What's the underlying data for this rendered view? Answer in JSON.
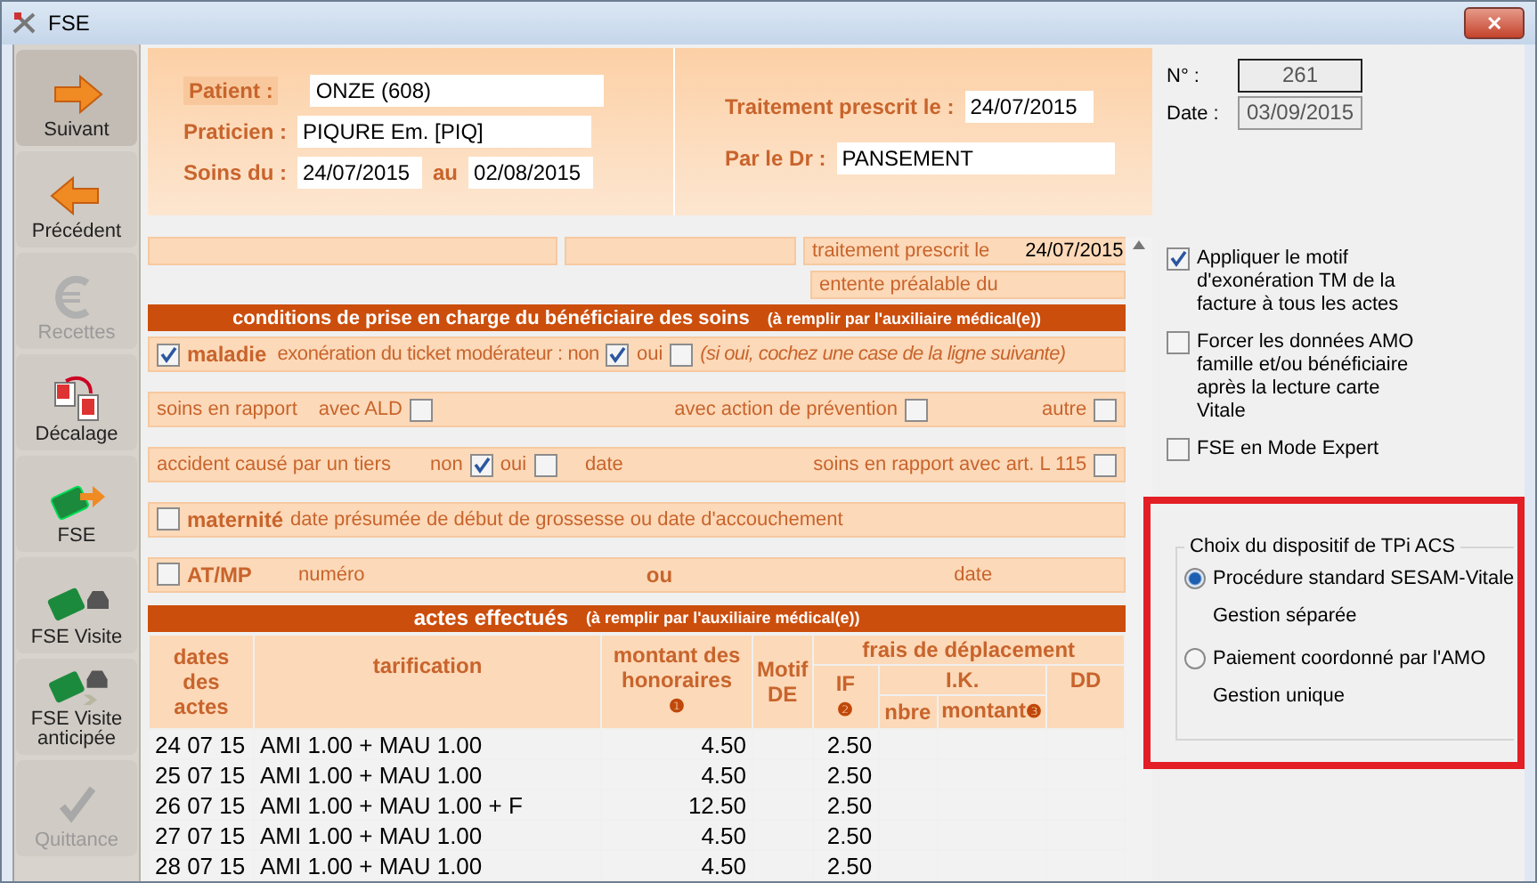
{
  "window": {
    "title": "FSE",
    "close": "✕"
  },
  "sidebar": {
    "items": [
      {
        "label": "Suivant",
        "kind": "next",
        "selected": true,
        "disabled": false
      },
      {
        "label": "Précédent",
        "kind": "previous",
        "selected": false,
        "disabled": false
      },
      {
        "label": "Recettes",
        "kind": "euro",
        "selected": false,
        "disabled": true
      },
      {
        "label": "Décalage",
        "kind": "calendar",
        "selected": false,
        "disabled": false
      },
      {
        "label": "FSE",
        "kind": "card",
        "selected": false,
        "disabled": false
      },
      {
        "label": "FSE Visite",
        "kind": "card-car",
        "selected": false,
        "disabled": false
      },
      {
        "label": "FSE Visite anticipée",
        "kind": "card-car-fast",
        "selected": false,
        "disabled": false
      },
      {
        "label": "Quittance",
        "kind": "check",
        "selected": false,
        "disabled": true
      }
    ]
  },
  "header": {
    "patient": {
      "label": "Patient :",
      "value": "ONZE (608)"
    },
    "praticien": {
      "label": "Praticien :",
      "value": "PIQURE Em. [PIQ]"
    },
    "soins": {
      "label": "Soins du :",
      "from": "24/07/2015",
      "to_label": "au",
      "to": "02/08/2015"
    },
    "traitement": {
      "label": "Traitement prescrit le :",
      "value": "24/07/2015"
    },
    "docteur": {
      "label": "Par le Dr :",
      "value": "PANSEMENT"
    }
  },
  "invoice": {
    "number": {
      "label": "N° :",
      "value": "261"
    },
    "date": {
      "label": "Date :",
      "value": "03/09/2015"
    }
  },
  "prescription": [
    {
      "label": "traitement prescrit le",
      "value": "24/07/2015"
    },
    {
      "label": "entente préalable du"
    }
  ],
  "conditions": {
    "title": "conditions de prise en charge du bénéficiaire des soins",
    "note": "(à remplir par l'auxiliaire médical(e))",
    "maladie": {
      "label": "maladie",
      "checked": true,
      "exoneration": "exonération du ticket modérateur : non",
      "non_checked": true,
      "oui": "oui",
      "oui_checked": false,
      "hint": "(si oui, cochez une case de la ligne suivante)"
    },
    "soins": {
      "label": "soins en rapport",
      "ald": "avec ALD",
      "ald_checked": false,
      "prevention": "avec action de prévention",
      "prevention_checked": false,
      "autre": "autre",
      "autre_checked": false
    },
    "accident": {
      "label": "accident causé par un tiers",
      "non": "non",
      "non_checked": true,
      "oui": "oui",
      "oui_checked": false,
      "date": "date",
      "l115": "soins en rapport avec art. L 115",
      "l115_checked": false
    },
    "maternite": {
      "label": "maternité",
      "checked": false,
      "text": "date présumée de début de grossesse ou date d'accouchement"
    },
    "atmp": {
      "label": "AT/MP",
      "checked": false,
      "numero": "numéro",
      "ou": "ou",
      "date": "date"
    }
  },
  "acts": {
    "title": "actes effectués",
    "note": "(à remplir par l'auxiliaire médical(e))",
    "columns": {
      "dates": "dates des actes",
      "tarification": "tarification",
      "montant": "montant des honoraires",
      "montant_mark": "❶",
      "motif": "Motif DE",
      "frais": "frais de déplacement",
      "if": "IF",
      "if_mark": "❷",
      "ik": "I.K.",
      "dd": "DD",
      "nbre": "nbre",
      "ik_montant": "montant",
      "ik_mark": "❸"
    },
    "rows": [
      {
        "date": "24 07 15",
        "tarification": "AMI 1.00 +  MAU 1.00",
        "montant": "4.50",
        "if": "2.50"
      },
      {
        "date": "25 07 15",
        "tarification": "AMI 1.00 +  MAU 1.00",
        "montant": "4.50",
        "if": "2.50"
      },
      {
        "date": "26 07 15",
        "tarification": "AMI 1.00 +  MAU 1.00 + F",
        "montant": "12.50",
        "if": "2.50"
      },
      {
        "date": "27 07 15",
        "tarification": "AMI 1.00 +  MAU 1.00",
        "montant": "4.50",
        "if": "2.50"
      },
      {
        "date": "28 07 15",
        "tarification": "AMI 1.00 +  MAU 1.00",
        "montant": "4.50",
        "if": "2.50"
      }
    ]
  },
  "options": [
    {
      "label": "Appliquer le motif d'exonération TM de la facture à tous les actes",
      "checked": true
    },
    {
      "label": "Forcer les données AMO famille et/ou bénéficiaire après la lecture carte Vitale",
      "checked": false
    },
    {
      "label": "FSE en Mode Expert",
      "checked": false
    }
  ],
  "tpi": {
    "title": "Choix du dispositif de TPi ACS",
    "options": [
      {
        "label": "Procédure standard SESAM-Vitale",
        "sublabel": "Gestion séparée",
        "selected": true
      },
      {
        "label": "Paiement coordonné par l'AMO",
        "sublabel": "Gestion unique",
        "selected": false
      }
    ]
  }
}
